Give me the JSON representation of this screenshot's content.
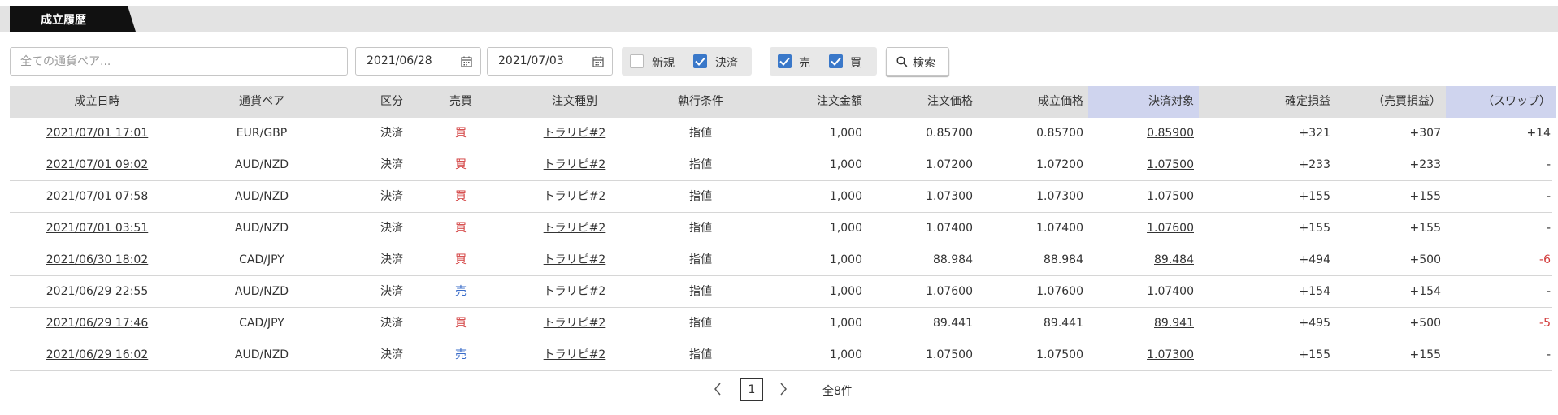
{
  "tab": {
    "label": "成立履歴"
  },
  "filters": {
    "pair_placeholder": "全ての通貨ペア...",
    "date_from": "2021/06/28",
    "date_to": "2021/07/03",
    "type_new": {
      "label": "新規",
      "checked": false
    },
    "type_settle": {
      "label": "決済",
      "checked": true
    },
    "side_sell": {
      "label": "売",
      "checked": true
    },
    "side_buy": {
      "label": "買",
      "checked": true
    },
    "search_label": "検索"
  },
  "table": {
    "headers": [
      "成立日時",
      "通貨ペア",
      "区分",
      "売買",
      "注文種別",
      "執行条件",
      "注文金額",
      "注文価格",
      "成立価格",
      "決済対象",
      "確定損益",
      "（売買損益）",
      "（スワップ）"
    ],
    "rows": [
      [
        "2021/07/01 17:01",
        "EUR/GBP",
        "決済",
        "買",
        "トラリピ#2",
        "指値",
        "1,000",
        "0.85700",
        "0.85700",
        "0.85900",
        "+321",
        "+307",
        "+14"
      ],
      [
        "2021/07/01 09:02",
        "AUD/NZD",
        "決済",
        "買",
        "トラリピ#2",
        "指値",
        "1,000",
        "1.07200",
        "1.07200",
        "1.07500",
        "+233",
        "+233",
        "-"
      ],
      [
        "2021/07/01 07:58",
        "AUD/NZD",
        "決済",
        "買",
        "トラリピ#2",
        "指値",
        "1,000",
        "1.07300",
        "1.07300",
        "1.07500",
        "+155",
        "+155",
        "-"
      ],
      [
        "2021/07/01 03:51",
        "AUD/NZD",
        "決済",
        "買",
        "トラリピ#2",
        "指値",
        "1,000",
        "1.07400",
        "1.07400",
        "1.07600",
        "+155",
        "+155",
        "-"
      ],
      [
        "2021/06/30 18:02",
        "CAD/JPY",
        "決済",
        "買",
        "トラリピ#2",
        "指値",
        "1,000",
        "88.984",
        "88.984",
        "89.484",
        "+494",
        "+500",
        "-6"
      ],
      [
        "2021/06/29 22:55",
        "AUD/NZD",
        "決済",
        "売",
        "トラリピ#2",
        "指値",
        "1,000",
        "1.07600",
        "1.07600",
        "1.07400",
        "+154",
        "+154",
        "-"
      ],
      [
        "2021/06/29 17:46",
        "CAD/JPY",
        "決済",
        "買",
        "トラリピ#2",
        "指値",
        "1,000",
        "89.441",
        "89.441",
        "89.941",
        "+495",
        "+500",
        "-5"
      ],
      [
        "2021/06/29 16:02",
        "AUD/NZD",
        "決済",
        "売",
        "トラリピ#2",
        "指値",
        "1,000",
        "1.07500",
        "1.07500",
        "1.07300",
        "+155",
        "+155",
        "-"
      ]
    ]
  },
  "pagination": {
    "current": "1",
    "total": "全8件"
  },
  "colors": {
    "checkbox_on": "#3a78c9",
    "buy": "#d23a3a",
    "sell": "#3a6cc9",
    "negative": "#d23a3a",
    "highlight_header": "#cfd4ee"
  }
}
